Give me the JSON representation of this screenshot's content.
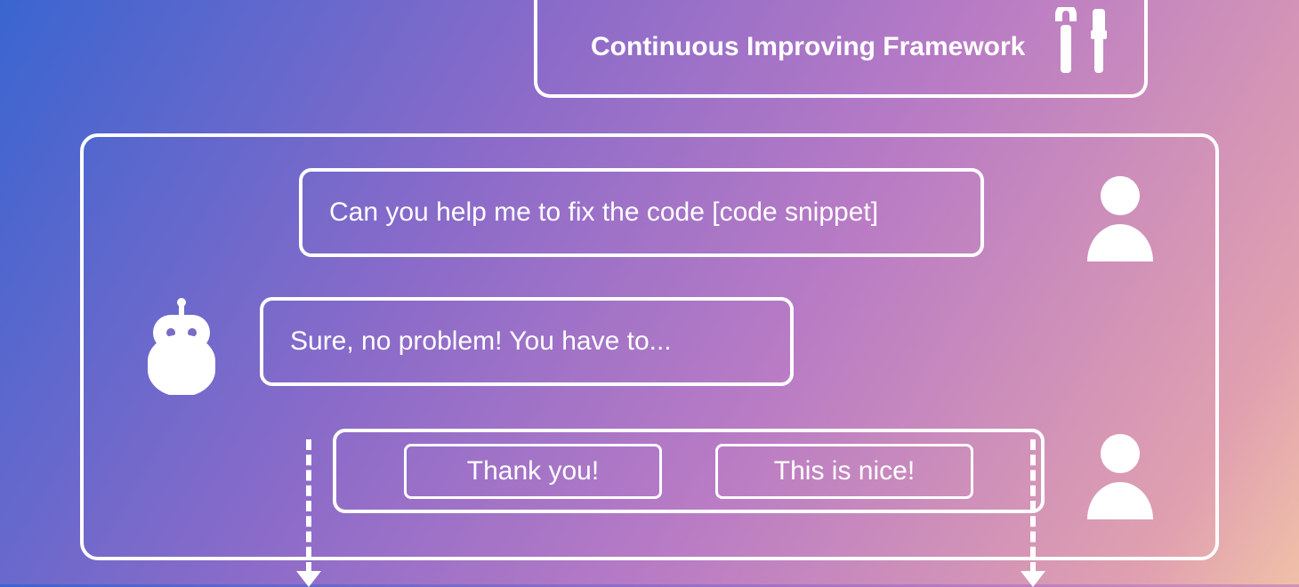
{
  "framework": {
    "title": "Continuous Improving Framework"
  },
  "conversation": {
    "user_msg1": "Can you help me to fix the code [code snippet]",
    "bot_msg": "Sure, no problem! You have to...",
    "user_reply_a": "Thank you!",
    "user_reply_b": "This is nice!"
  }
}
